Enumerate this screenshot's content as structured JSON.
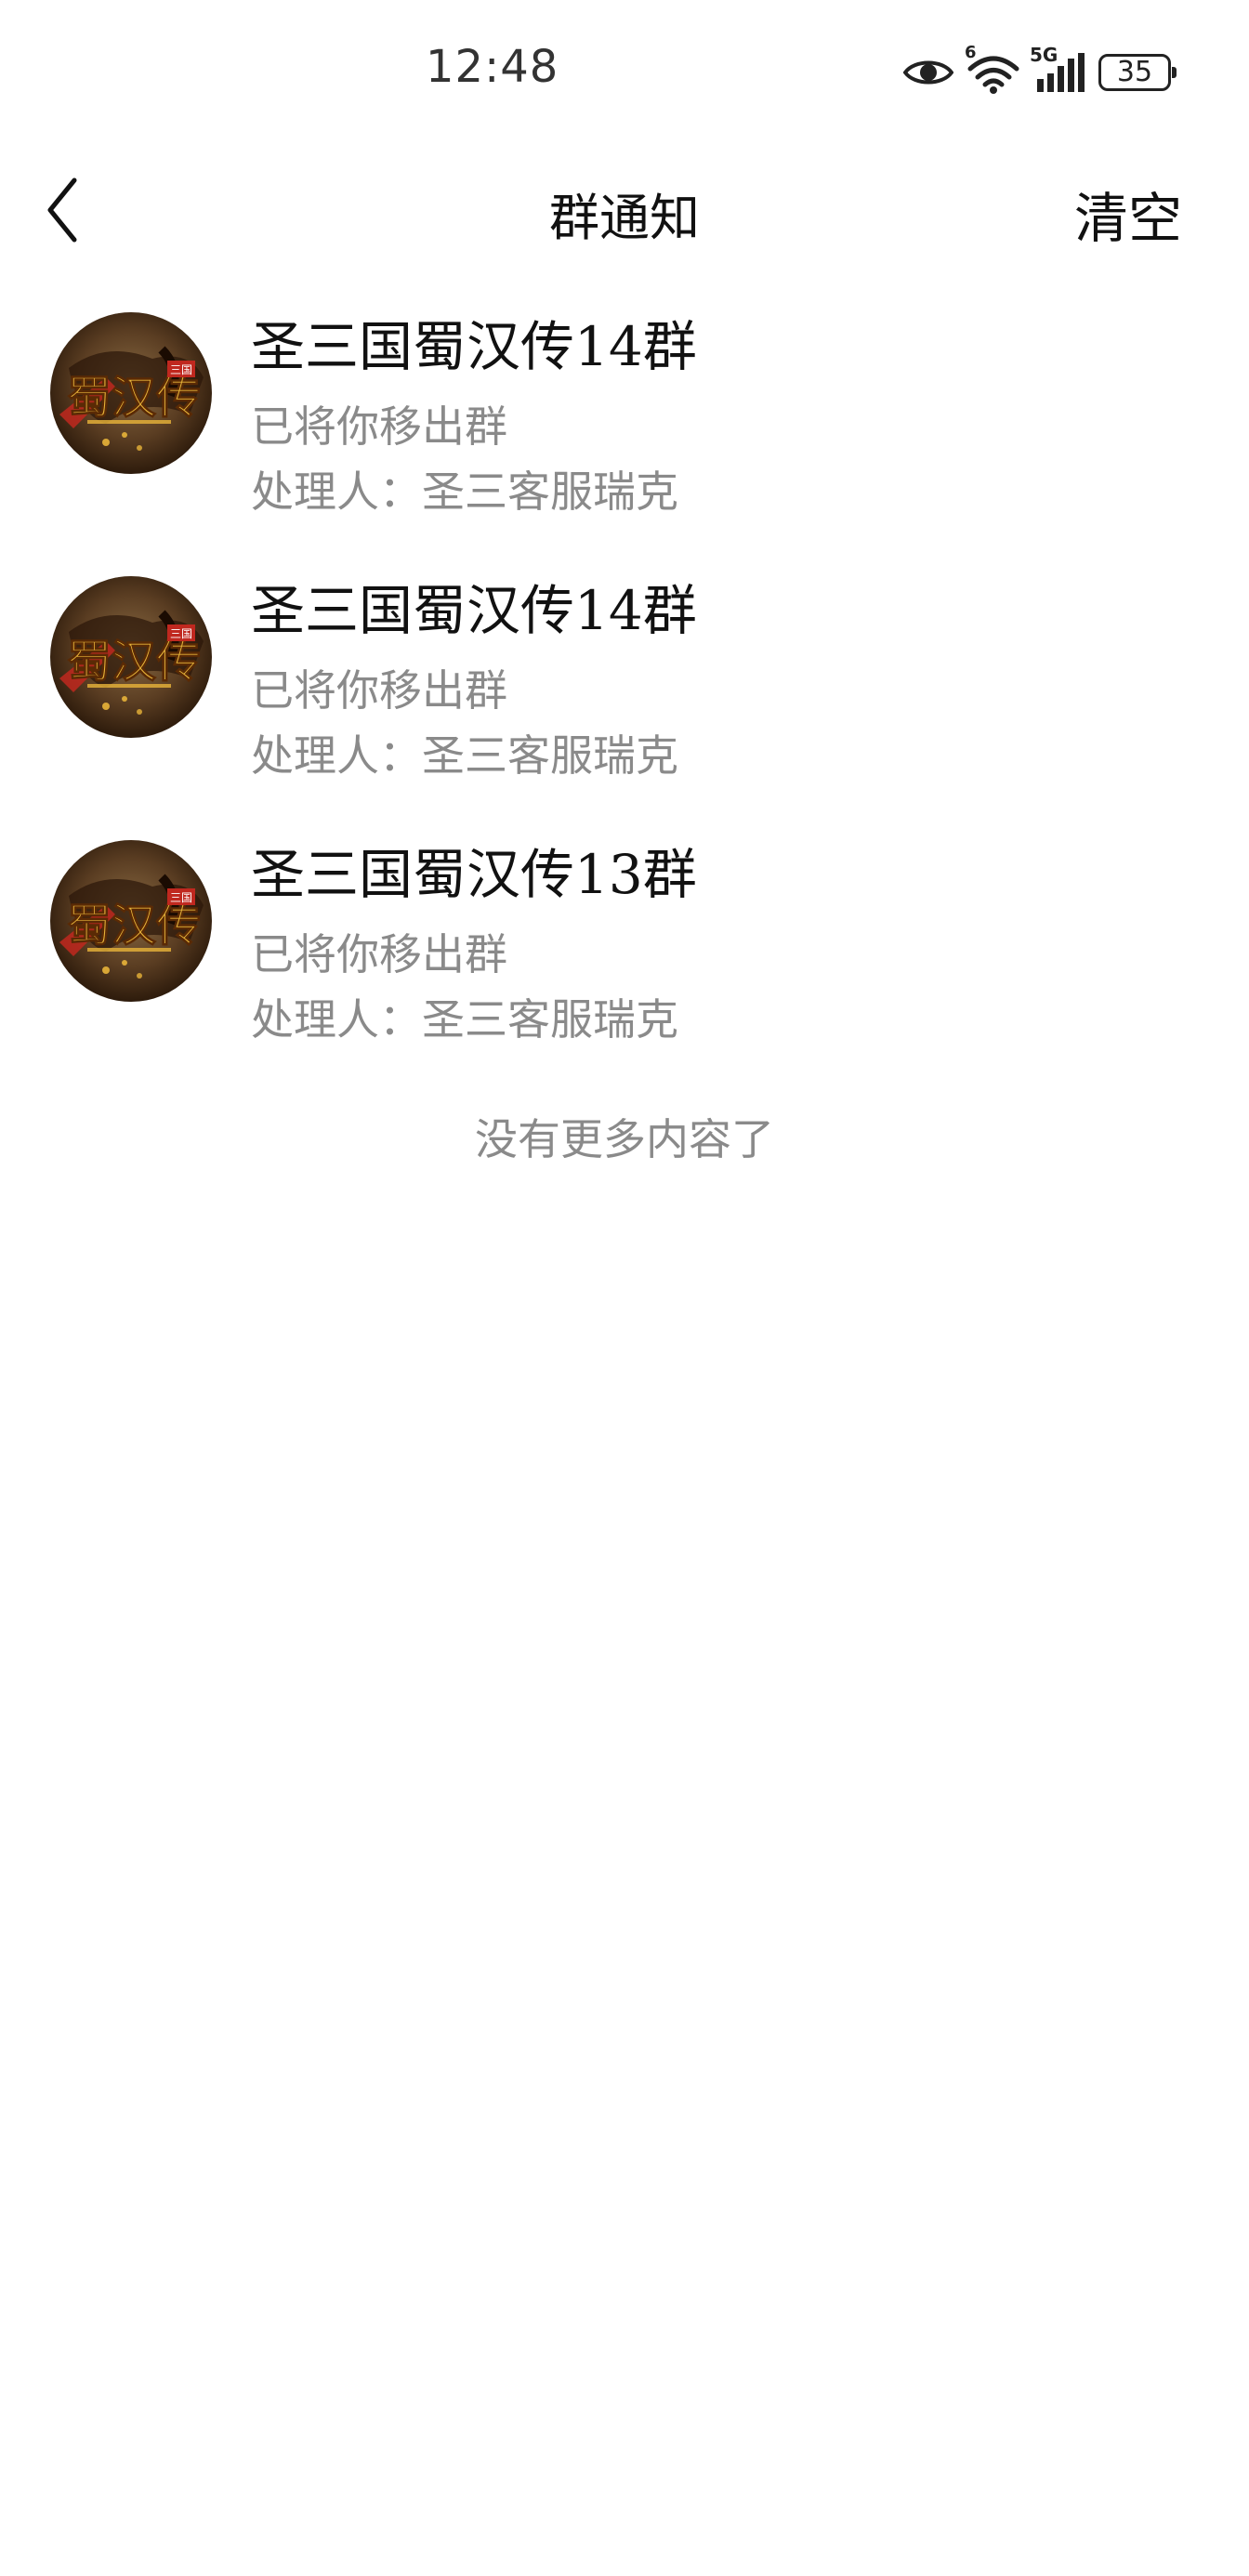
{
  "status_bar": {
    "time": "12:48",
    "network_label": "5G",
    "wifi_label": "6",
    "battery": "35",
    "icons": [
      "eye-icon",
      "wifi-icon",
      "signal-icon",
      "battery-icon"
    ]
  },
  "header": {
    "back_icon": "chevron-left-icon",
    "title": "群通知",
    "clear_label": "清空"
  },
  "notifications": [
    {
      "group_name": "圣三国蜀汉传14群",
      "action": "已将你移出群",
      "handler": "处理人：圣三客服瑞克"
    },
    {
      "group_name": "圣三国蜀汉传14群",
      "action": "已将你移出群",
      "handler": "处理人：圣三客服瑞克"
    },
    {
      "group_name": "圣三国蜀汉传13群",
      "action": "已将你移出群",
      "handler": "处理人：圣三客服瑞克"
    }
  ],
  "avatar_logo_text": "蜀汉传",
  "avatar_badge_text": "三国",
  "footer": {
    "no_more": "没有更多内容了"
  },
  "colors": {
    "background": "#ffffff",
    "primary_text": "#111111",
    "secondary_text": "#8a8a8a",
    "logo_gold": "#e8b43a",
    "logo_red": "#c0281f"
  }
}
